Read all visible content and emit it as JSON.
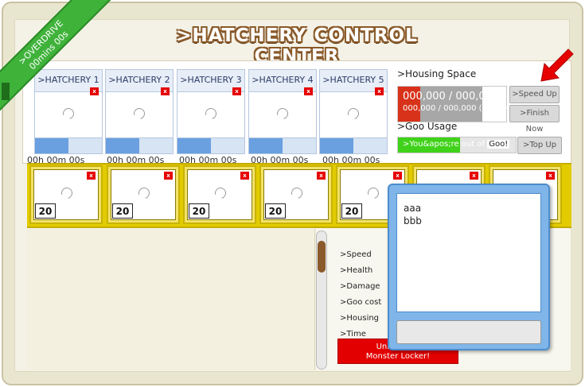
{
  "title": ">HATCHERY CONTROL CENTER",
  "overdrive": {
    "line1": ">OVERDRIVE",
    "line2": "00mins 00s"
  },
  "hatcheries": [
    {
      "label": ">HATCHERY 1",
      "time": "00h 00m 00s",
      "progress": 0.5
    },
    {
      "label": ">HATCHERY 2",
      "time": "00h 00m 00s",
      "progress": 0.5
    },
    {
      "label": ">HATCHERY 3",
      "time": "00h 00m 00s",
      "progress": 0.5
    },
    {
      "label": ">HATCHERY 4",
      "time": "00h 00m 00s",
      "progress": 0.5
    },
    {
      "label": ">HATCHERY 5",
      "time": "00h 00m 00s",
      "progress": 0.5
    }
  ],
  "close_glyph": "x",
  "housing": {
    "label": ">Housing Space",
    "value": "000,000 / 000,000",
    "sub": "000,000 / 000,000 (OVER)",
    "speed_up": ">Speed Up",
    "finish_now": ">Finish Now"
  },
  "goo": {
    "label": ">Goo Usage",
    "text": ">You&apos;re out of",
    "word": "Goo!",
    "top_up": ">Top Up"
  },
  "slots": [
    {
      "level": "20"
    },
    {
      "level": "20"
    },
    {
      "level": "20"
    },
    {
      "level": "20"
    },
    {
      "level": "20"
    },
    {
      "level": ""
    },
    {
      "level": ""
    }
  ],
  "stats": [
    ">Speed",
    ">Health",
    ">Damage",
    ">Goo cost",
    ">Housing",
    ">Time"
  ],
  "unlock": {
    "line1": "Unlock xxx",
    "line2": "Monster Locker!"
  },
  "popup": {
    "items": [
      "aaa",
      "bbb"
    ]
  },
  "colors": {
    "accent_red": "#e60000",
    "goo_green": "#40d21a",
    "ribbon_green": "#3fb23a",
    "popup_blue": "#7fb5e8"
  }
}
